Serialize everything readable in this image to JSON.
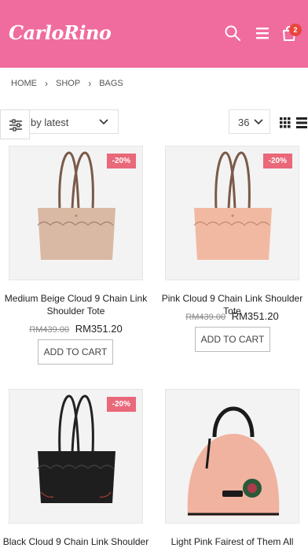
{
  "header": {
    "logo_text": "CarloRino",
    "cart_count": "2",
    "bg_color": "#f06b9e"
  },
  "breadcrumb": {
    "items": [
      "HOME",
      "SHOP",
      "BAGS"
    ]
  },
  "toolbar": {
    "sort_value": "by latest",
    "per_page_value": "36"
  },
  "products": [
    {
      "name": "Medium Beige Cloud 9 Chain Link Shoulder Tote",
      "discount": "-20%",
      "old_price": "RM439.00",
      "new_price": "RM351.20",
      "button_label": "ADD TO CART",
      "bag_color": "#d9b9a3"
    },
    {
      "name": "Pink Cloud 9 Chain Link Shoulder Tote",
      "discount": "-20%",
      "old_price": "RM439.00",
      "new_price": "RM351.20",
      "button_label": "ADD TO CART",
      "bag_color": "#f2b9a2"
    },
    {
      "name": "Black Cloud 9 Chain Link Shoulder",
      "discount": "-20%",
      "bag_color": "#1e1e1e"
    },
    {
      "name": "Light Pink Fairest of Them All Round",
      "bag_color": "#efb3a0"
    }
  ]
}
